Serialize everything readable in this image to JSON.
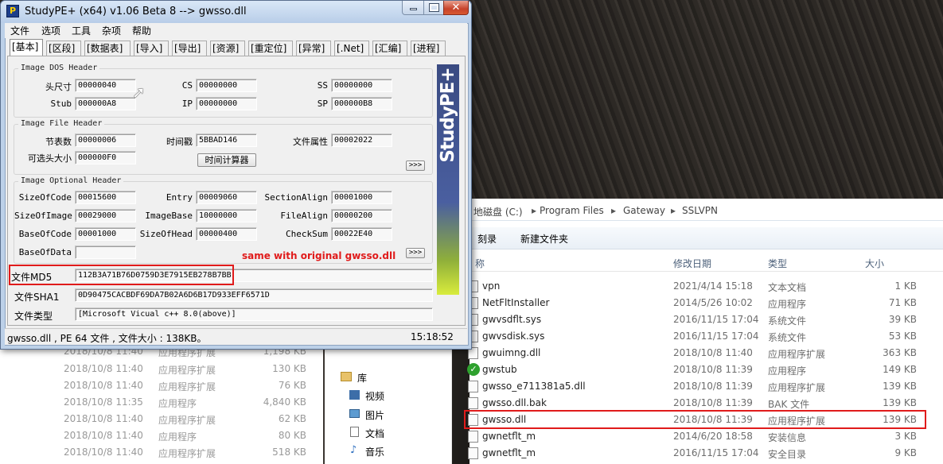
{
  "window": {
    "title": "StudyPE+ (x64) v1.06 Beta 8  --> gwsso.dll",
    "app_icon_letter": "P",
    "close_glyph": "✕"
  },
  "menu": [
    "文件",
    "选项",
    "工具",
    "杂项",
    "帮助"
  ],
  "tabs": [
    "[基本]",
    "[区段]",
    "[数据表]",
    "[导入]",
    "[导出]",
    "[资源]",
    "[重定位]",
    "[异常]",
    "[.Net]",
    "[汇编]",
    "[进程]"
  ],
  "dos_header": {
    "title": "Image DOS Header",
    "head_size_label": "头尺寸",
    "head_size": "00000040",
    "stub_label": "Stub",
    "stub": "000000A8",
    "cs_label": "CS",
    "cs": "00000000",
    "ip_label": "IP",
    "ip": "00000000",
    "ss_label": "SS",
    "ss": "00000000",
    "sp_label": "SP",
    "sp": "000000B8"
  },
  "file_header": {
    "title": "Image File Header",
    "sections_label": "节表数",
    "sections": "00000006",
    "opt_size_label": "可选头大小",
    "opt_size": "000000F0",
    "timestamp_label": "时间戳",
    "timestamp": "5BBAD146",
    "calc_button": "时间计算器",
    "attr_label": "文件属性",
    "attr": "00002022",
    "more_button": ">>>"
  },
  "optional_header": {
    "title": "Image Optional Header",
    "size_of_code_label": "SizeOfCode",
    "size_of_code": "00015600",
    "size_of_image_label": "SizeOfImage",
    "size_of_image": "00029000",
    "base_of_code_label": "BaseOfCode",
    "base_of_code": "00001000",
    "base_of_data_label": "BaseOfData",
    "entry_label": "Entry",
    "entry": "00009060",
    "image_base_label": "ImageBase",
    "image_base": "10000000",
    "size_of_head_label": "SizeOfHead",
    "size_of_head": "00000400",
    "section_align_label": "SectionAlign",
    "section_align": "00001000",
    "file_align_label": "FileAlign",
    "file_align": "00000200",
    "checksum_label": "CheckSum",
    "checksum": "00022E40",
    "more_button": ">>>"
  },
  "hashes": {
    "md5_label": "文件MD5",
    "md5": "112B3A71B76D0759D3E7915EB278B7BB",
    "sha1_label": "文件SHA1",
    "sha1": "0D90475CACBDF69DA7B02A6D6B17D933EFF6571D",
    "type_label": "文件类型",
    "type": "[Microsoft Vicual c++ 8.0(above)]"
  },
  "annotation": "same with original gwsso.dll",
  "banner_text": "StudyPE+",
  "status": {
    "info": "gwsso.dll , PE 64 文件 , 文件大小 : 138KB。",
    "time": "15:18:52"
  },
  "left_explorer_rows": [
    {
      "date": "2018/10/8 11:40",
      "type": "应用程序扩展",
      "size": "1,198 KB"
    },
    {
      "date": "2018/10/8 11:40",
      "type": "应用程序扩展",
      "size": "130 KB"
    },
    {
      "date": "2018/10/8 11:40",
      "type": "应用程序扩展",
      "size": "76 KB"
    },
    {
      "date": "2018/10/8 11:35",
      "type": "应用程序",
      "size": "4,840 KB"
    },
    {
      "date": "2018/10/8 11:40",
      "type": "应用程序扩展",
      "size": "62 KB"
    },
    {
      "date": "2018/10/8 11:40",
      "type": "应用程序",
      "size": "80 KB"
    },
    {
      "date": "2018/10/8 11:40",
      "type": "应用程序扩展",
      "size": "518 KB"
    }
  ],
  "explorer": {
    "breadcrumb": [
      "地磁盘 (C:)",
      "Program Files",
      "Gateway",
      "SSLVPN"
    ],
    "toolbar": [
      "刻录",
      "新建文件夹"
    ],
    "columns": [
      "称",
      "修改日期",
      "类型",
      "大小"
    ],
    "nav_items": [
      "库",
      "视频",
      "图片",
      "文档",
      "音乐"
    ],
    "files": [
      {
        "name": "vpn",
        "date": "2021/4/14 15:18",
        "type": "文本文档",
        "size": "1 KB"
      },
      {
        "name": "NetFltInstaller",
        "date": "2014/5/26 10:02",
        "type": "应用程序",
        "size": "71 KB"
      },
      {
        "name": "gwvsdflt.sys",
        "date": "2016/11/15 17:04",
        "type": "系统文件",
        "size": "39 KB"
      },
      {
        "name": "gwvsdisk.sys",
        "date": "2016/11/15 17:04",
        "type": "系统文件",
        "size": "53 KB"
      },
      {
        "name": "gwuimng.dll",
        "date": "2018/10/8 11:40",
        "type": "应用程序扩展",
        "size": "363 KB"
      },
      {
        "name": "gwstub",
        "date": "2018/10/8 11:39",
        "type": "应用程序",
        "size": "149 KB"
      },
      {
        "name": "gwsso_e711381a5.dll",
        "date": "2018/10/8 11:39",
        "type": "应用程序扩展",
        "size": "139 KB"
      },
      {
        "name": "gwsso.dll.bak",
        "date": "2018/10/8 11:39",
        "type": "BAK 文件",
        "size": "139 KB"
      },
      {
        "name": "gwsso.dll",
        "date": "2018/10/8 11:39",
        "type": "应用程序扩展",
        "size": "139 KB"
      },
      {
        "name": "gwnetflt_m",
        "date": "2014/6/20 18:58",
        "type": "安装信息",
        "size": "3 KB"
      },
      {
        "name": "gwnetflt_m",
        "date": "2016/11/15 17:04",
        "type": "安全目录",
        "size": "9 KB"
      }
    ]
  }
}
